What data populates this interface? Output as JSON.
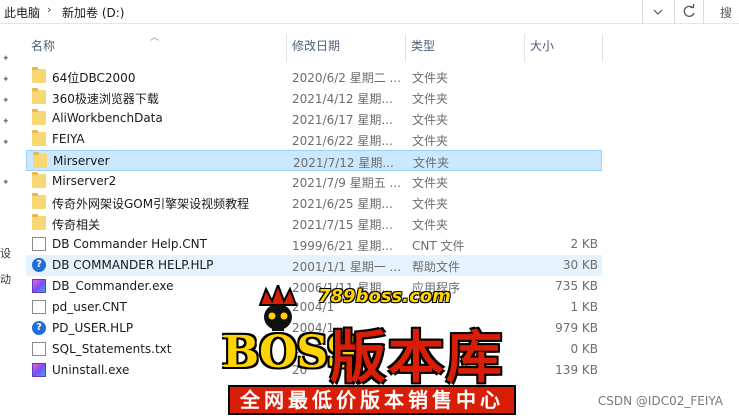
{
  "address": {
    "crumbs": [
      "此电脑",
      "新加卷 (D:)"
    ],
    "search_placeholder": "搜"
  },
  "nav": {
    "text_items": [
      "设",
      "动"
    ]
  },
  "columns": {
    "name": "名称",
    "date": "修改日期",
    "type": "类型",
    "size": "大小"
  },
  "files": [
    {
      "name": "64位DBC2000",
      "date": "2020/6/2 星期二 ...",
      "type": "文件夹",
      "size": "",
      "icon": "folder-icon"
    },
    {
      "name": "360极速浏览器下载",
      "date": "2021/4/12 星期...",
      "type": "文件夹",
      "size": "",
      "icon": "folder-icon"
    },
    {
      "name": "AliWorkbenchData",
      "date": "2021/6/17 星期...",
      "type": "文件夹",
      "size": "",
      "icon": "folder-icon"
    },
    {
      "name": "FEIYA",
      "date": "2021/6/22 星期...",
      "type": "文件夹",
      "size": "",
      "icon": "folder-icon"
    },
    {
      "name": "Mirserver",
      "date": "2021/7/12 星期...",
      "type": "文件夹",
      "size": "",
      "icon": "folder-icon"
    },
    {
      "name": "Mirserver2",
      "date": "2021/7/9 星期五 ...",
      "type": "文件夹",
      "size": "",
      "icon": "folder-icon"
    },
    {
      "name": "传奇外网架设GOM引擎架设视频教程",
      "date": "2021/6/25 星期...",
      "type": "文件夹",
      "size": "",
      "icon": "folder-icon"
    },
    {
      "name": "传奇相关",
      "date": "2021/7/15 星期...",
      "type": "文件夹",
      "size": "",
      "icon": "folder-icon"
    },
    {
      "name": "DB Commander Help.CNT",
      "date": "1999/6/21 星期...",
      "type": "CNT 文件",
      "size": "2 KB",
      "icon": "document-icon"
    },
    {
      "name": "DB COMMANDER HELP.HLP",
      "date": "2001/1/1 星期一 ...",
      "type": "帮助文件",
      "size": "30 KB",
      "icon": "help-file-icon"
    },
    {
      "name": "DB_Commander.exe",
      "date": "2006/1/11 星期...",
      "type": "应用程序",
      "size": "735 KB",
      "icon": "application-icon"
    },
    {
      "name": "pd_user.CNT",
      "date": "2004/1",
      "type": "",
      "size": "1 KB",
      "icon": "document-icon"
    },
    {
      "name": "PD_USER.HLP",
      "date": "2004/1",
      "type": "",
      "size": "979 KB",
      "icon": "help-file-icon"
    },
    {
      "name": "SQL_Statements.txt",
      "date": "2005",
      "type": "",
      "size": "0 KB",
      "icon": "text-file-icon"
    },
    {
      "name": "Uninstall.exe",
      "date": "20",
      "type": "",
      "size": "139 KB",
      "icon": "application-icon"
    }
  ],
  "selected_index": 4,
  "hover_index": 9,
  "watermark": {
    "url": "789boss.com",
    "boss": "BOSS",
    "title": "版本库",
    "slogan": "全网最低价版本销售中心"
  },
  "credit": "CSDN @IDC02_FEIYA",
  "colors": {
    "selection": "#cce8ff",
    "selection_border": "#99d1ff",
    "hover": "#e5f3ff",
    "folder": "#f8d775",
    "watermark_red": "#d81e06",
    "watermark_yellow": "#ffd400"
  }
}
